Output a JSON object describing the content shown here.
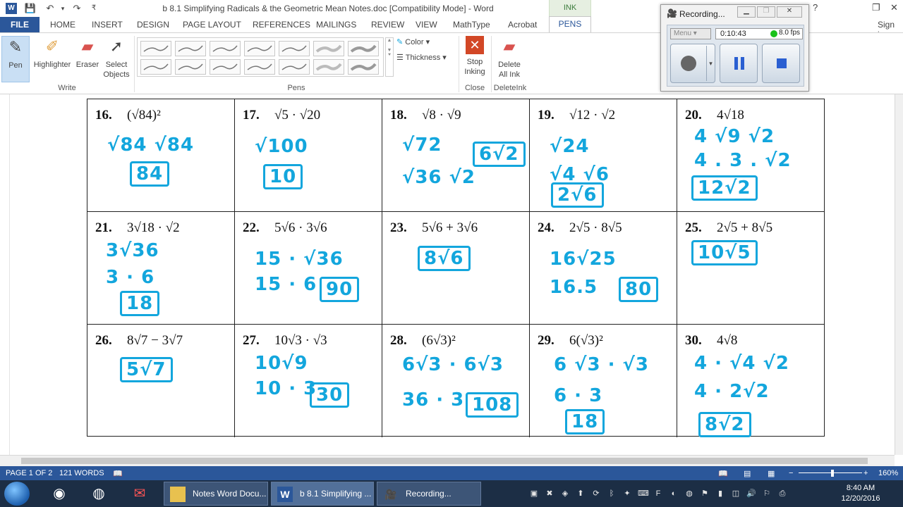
{
  "window": {
    "title": "b 8.1 Simplifying Radicals & the Geometric Mean Notes.doc [Compatibility Mode] - Word",
    "context_tab": "INK TOOLS",
    "sign_in": "Sign in",
    "help": "?"
  },
  "tabs": [
    "FILE",
    "HOME",
    "INSERT",
    "DESIGN",
    "PAGE LAYOUT",
    "REFERENCES",
    "MAILINGS",
    "REVIEW",
    "VIEW",
    "MathType",
    "Acrobat",
    "PENS"
  ],
  "ribbon": {
    "write": {
      "pen": "Pen",
      "highlighter": "Highlighter",
      "eraser": "Eraser",
      "select_objects": "Select Objects",
      "group": "Write"
    },
    "pens": {
      "color": "Color",
      "thickness": "Thickness",
      "group": "Pens"
    },
    "close": {
      "stop_inking": "Stop Inking",
      "group": "Close"
    },
    "deleteink": {
      "delete_all_ink": "Delete All Ink",
      "group": "DeleteInk"
    }
  },
  "problems": [
    {
      "num": "16.",
      "expr": "(√84)²",
      "work": [
        "√84 √84"
      ],
      "answer": "84"
    },
    {
      "num": "17.",
      "expr": "√5 · √20",
      "work": [
        "√100"
      ],
      "answer": "10"
    },
    {
      "num": "18.",
      "expr": "√8 · √9",
      "work": [
        "√72",
        "√36 √2"
      ],
      "answer": "6√2"
    },
    {
      "num": "19.",
      "expr": "√12 · √2",
      "work": [
        "√24",
        "√4 √6"
      ],
      "answer": "2√6"
    },
    {
      "num": "20.",
      "expr": "4√18",
      "work": [
        "4 √9 √2",
        "4 . 3 . √2"
      ],
      "answer": "12√2"
    },
    {
      "num": "21.",
      "expr": "3√18 · √2",
      "work": [
        "3√36",
        "3 · 6"
      ],
      "answer": "18"
    },
    {
      "num": "22.",
      "expr": "5√6 · 3√6",
      "work": [
        "15 · √36",
        "15 · 6"
      ],
      "answer": "90"
    },
    {
      "num": "23.",
      "expr": "5√6 + 3√6",
      "work": [],
      "answer": "8√6"
    },
    {
      "num": "24.",
      "expr": "2√5 · 8√5",
      "work": [
        "16√25",
        "16.5"
      ],
      "answer": "80"
    },
    {
      "num": "25.",
      "expr": "2√5 + 8√5",
      "work": [],
      "answer": "10√5"
    },
    {
      "num": "26.",
      "expr": "8√7 − 3√7",
      "work": [],
      "answer": "5√7"
    },
    {
      "num": "27.",
      "expr": "10√3 · √3",
      "work": [
        "10√9",
        "10 · 3"
      ],
      "answer": "30"
    },
    {
      "num": "28.",
      "expr": "(6√3)²",
      "work": [
        "6√3 · 6√3",
        "36 · 3"
      ],
      "answer": "108"
    },
    {
      "num": "29.",
      "expr": "6(√3)²",
      "work": [
        "6 √3 · √3",
        "6 · 3"
      ],
      "answer": "18"
    },
    {
      "num": "30.",
      "expr": "4√8",
      "work": [
        "4 · √4 √2",
        "4 · 2√2"
      ],
      "answer": "8√2"
    }
  ],
  "status": {
    "page": "PAGE 1 OF 2",
    "words": "121 WORDS",
    "zoom": "160%"
  },
  "recorder": {
    "title": "Recording...",
    "menu": "Menu",
    "time": "0:10:43",
    "fps": "8.0 fps"
  },
  "taskbar": {
    "windows": [
      {
        "label": "Notes Word Docu..."
      },
      {
        "label": "b 8.1 Simplifying ..."
      },
      {
        "label": "Recording..."
      }
    ],
    "clock_time": "8:40 AM",
    "clock_date": "12/20/2016"
  },
  "colors": {
    "ink": "#13a6dd",
    "word_blue": "#2b579a",
    "pen_selected": "#c9dff4"
  }
}
